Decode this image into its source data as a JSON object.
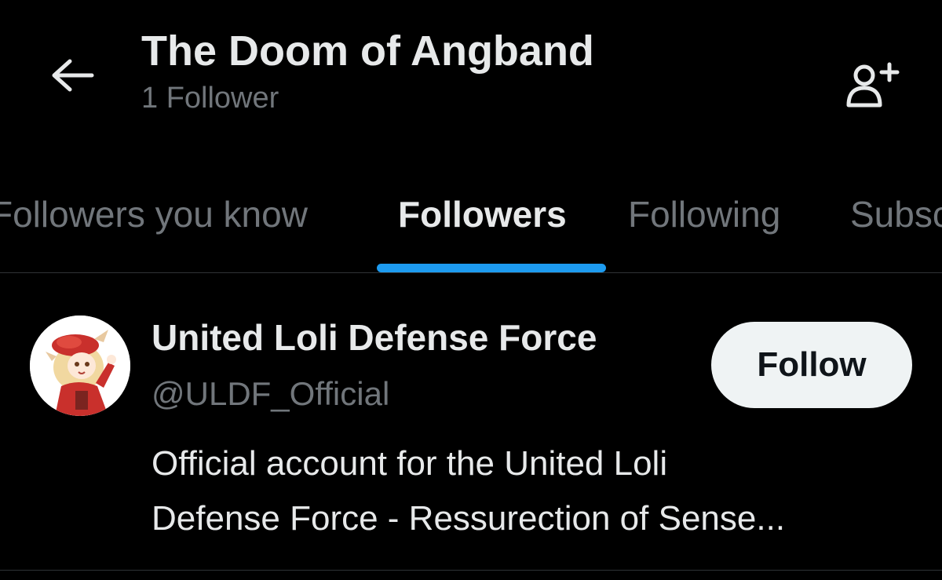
{
  "header": {
    "back_icon": "arrow-left-icon",
    "title": "The Doom of Angband",
    "subtitle": "1 Follower",
    "add_user_icon": "person-plus-icon"
  },
  "tabs": [
    {
      "label": "Followers you know",
      "active": false
    },
    {
      "label": "Followers",
      "active": true
    },
    {
      "label": "Following",
      "active": false
    },
    {
      "label": "Subscriptions",
      "active": false
    }
  ],
  "colors": {
    "background": "#000000",
    "text_primary": "#e7e9ea",
    "text_secondary": "#71767b",
    "accent": "#1d9bf0",
    "button_bg": "#eff3f4",
    "button_text": "#0f1419",
    "divider": "#2f3336"
  },
  "users": [
    {
      "name": "United Loli Defense Force",
      "handle": "@ULDF_Official",
      "bio_line1": "Official account for the United Loli",
      "bio_line2": "Defense Force - Ressurection of Sense...",
      "follow_label": "Follow"
    }
  ]
}
